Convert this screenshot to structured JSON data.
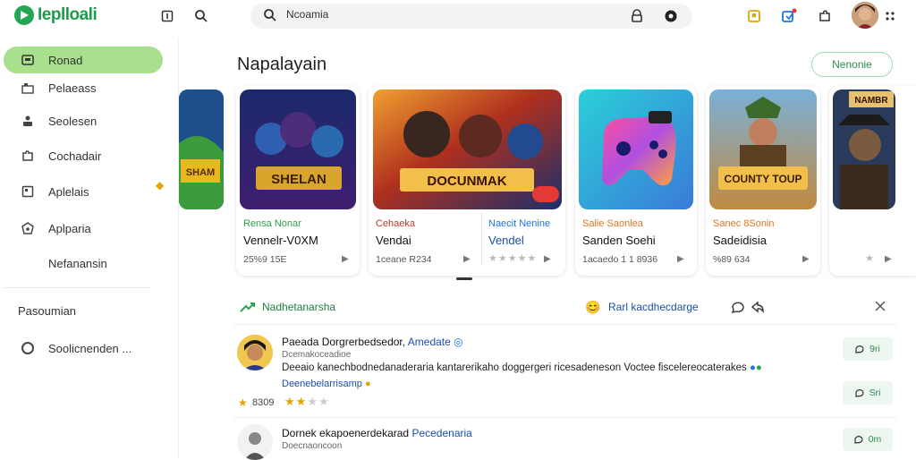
{
  "app": {
    "name": "Ieplloali"
  },
  "search": {
    "value": "Ncoamia"
  },
  "sidebar": {
    "items": [
      {
        "label": "Ronad",
        "icon": "inbox-icon"
      },
      {
        "label": "Pelaeass",
        "icon": "library-icon"
      },
      {
        "label": "Seolesen",
        "icon": "user-icon"
      },
      {
        "label": "Cochadair",
        "icon": "puzzle-icon"
      },
      {
        "label": "Aplelais",
        "icon": "apps-icon"
      },
      {
        "label": "Aplparia",
        "icon": "badge-icon"
      },
      {
        "label": "Nefanansin",
        "icon": ""
      }
    ],
    "section_label": "Pasoumian",
    "bottom_item": {
      "label": "Soolicnenden ..."
    }
  },
  "main": {
    "title": "Napalayain",
    "more_button": "Nenonie",
    "cards": [
      {
        "label": "Rensa Nonar",
        "title": "Vennelr-V0XM",
        "meta": "25%9 15E",
        "art_text": "SHELAN"
      },
      {
        "label": "Cehaeka",
        "title": "Vendai",
        "meta": "1ceane R234",
        "label2": "Naecit Nenine",
        "title2": "Vendel",
        "art_text": "DOCUNMAK"
      },
      {
        "label": "Salie Saonlea",
        "title": "Sanden Soehi",
        "meta": "1acaedo 1 1 8936"
      },
      {
        "label": "Sanec 8Sonin",
        "title": "Sadeidisia",
        "meta": "%89 634",
        "art_text": "COUNTY TOUP"
      },
      {
        "art_text": "NAMBR"
      }
    ]
  },
  "reviews": {
    "header_left": "Nadhetanarsha",
    "header_right": "Rarl kacdhecdarge",
    "items": [
      {
        "author": "Paeada Dorgrerbedsedor",
        "author_tag": "Amedate",
        "sub": "Dcemakoceadioe",
        "text": "Deeaio kanechbodnedanaderaria  kantarerikaho doggergeri ricesadeneson Voctee fiscelereocaterakes",
        "link": "Deenebelarrisamp",
        "rating": "8309",
        "action": "9ri"
      },
      {
        "author": "Dornek ekapoenerdekarad",
        "author_tag": "Pecedenaria",
        "sub": "Doecnaoncoon",
        "action": "Sri",
        "action2": "0m"
      }
    ]
  },
  "colors": {
    "accent": "#22a653",
    "active_bg": "#a8e08e"
  }
}
